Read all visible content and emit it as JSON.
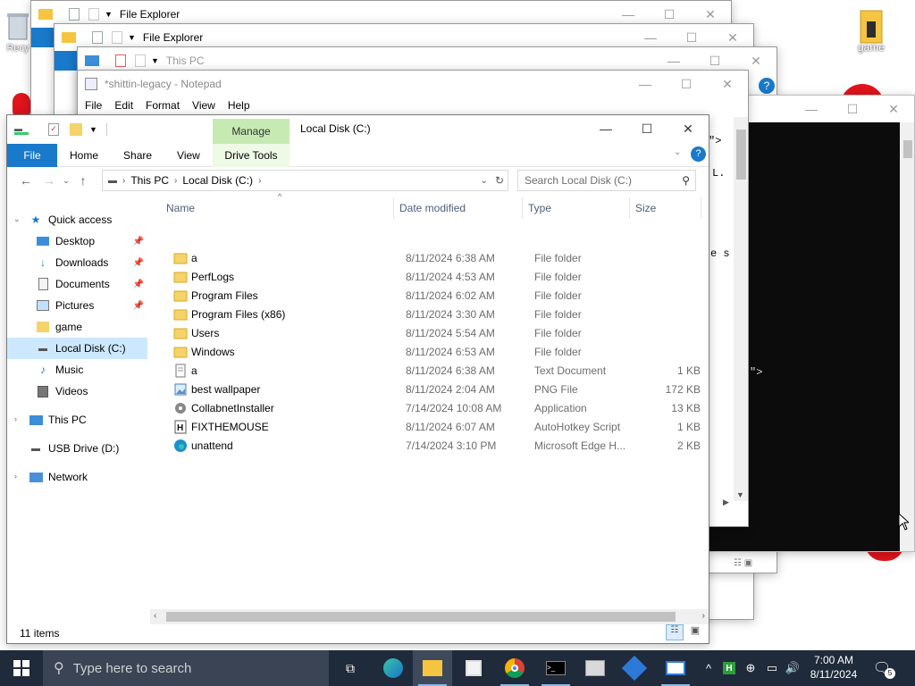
{
  "desktop": {
    "left_icon_label": "Recy",
    "right_icon_label": "game"
  },
  "bg_windows": {
    "explorer1_title": "File Explorer",
    "explorer2_title": "File Explorer",
    "thispc_title": "This PC",
    "notepad_title": "*shittin-legacy - Notepad",
    "notepad_menu": [
      "File",
      "Edit",
      "Format",
      "View",
      "Help"
    ],
    "cmd_fragments": [
      "\">",
      "L.",
      "e s",
      "\">"
    ]
  },
  "main": {
    "title": "Local Disk (C:)",
    "ribbon": {
      "file": "File",
      "home": "Home",
      "share": "Share",
      "view": "View",
      "manage": "Manage",
      "drive_tools": "Drive Tools"
    },
    "address": [
      "This PC",
      "Local Disk (C:)"
    ],
    "search_placeholder": "Search Local Disk (C:)",
    "columns": {
      "name": "Name",
      "date": "Date modified",
      "type": "Type",
      "size": "Size"
    },
    "nav": [
      {
        "label": "Quick access"
      },
      {
        "label": "Desktop"
      },
      {
        "label": "Downloads"
      },
      {
        "label": "Documents"
      },
      {
        "label": "Pictures"
      },
      {
        "label": "game"
      },
      {
        "label": "Local Disk (C:)"
      },
      {
        "label": "Music"
      },
      {
        "label": "Videos"
      },
      {
        "label": "This PC"
      },
      {
        "label": "USB Drive (D:)"
      },
      {
        "label": "Network"
      }
    ],
    "files": [
      {
        "name": "a",
        "date": "8/11/2024 6:38 AM",
        "type": "File folder",
        "size": "",
        "icon": "folder-icon"
      },
      {
        "name": "PerfLogs",
        "date": "8/11/2024 4:53 AM",
        "type": "File folder",
        "size": "",
        "icon": "folder-icon"
      },
      {
        "name": "Program Files",
        "date": "8/11/2024 6:02 AM",
        "type": "File folder",
        "size": "",
        "icon": "folder-icon"
      },
      {
        "name": "Program Files (x86)",
        "date": "8/11/2024 3:30 AM",
        "type": "File folder",
        "size": "",
        "icon": "folder-icon"
      },
      {
        "name": "Users",
        "date": "8/11/2024 5:54 AM",
        "type": "File folder",
        "size": "",
        "icon": "folder-icon"
      },
      {
        "name": "Windows",
        "date": "8/11/2024 6:53 AM",
        "type": "File folder",
        "size": "",
        "icon": "folder-icon"
      },
      {
        "name": "a",
        "date": "8/11/2024 6:38 AM",
        "type": "Text Document",
        "size": "1 KB",
        "icon": "text-file-icon"
      },
      {
        "name": "best wallpaper",
        "date": "8/11/2024 2:04 AM",
        "type": "PNG File",
        "size": "172 KB",
        "icon": "image-file-icon"
      },
      {
        "name": "CollabnetInstaller",
        "date": "7/14/2024 10:08 AM",
        "type": "Application",
        "size": "13 KB",
        "icon": "application-icon"
      },
      {
        "name": "FIXTHEMOUSE",
        "date": "8/11/2024 6:07 AM",
        "type": "AutoHotkey Script",
        "size": "1 KB",
        "icon": "autohotkey-script-icon"
      },
      {
        "name": "unattend",
        "date": "7/14/2024 3:10 PM",
        "type": "Microsoft Edge H...",
        "size": "2 KB",
        "icon": "edge-html-icon"
      }
    ],
    "status": "11 items"
  },
  "taskbar": {
    "search_placeholder": "Type here to search",
    "time": "7:00 AM",
    "date": "8/11/2024",
    "notification_count": "5"
  },
  "colors": {
    "accent": "#1979ca",
    "selection": "#cce8ff",
    "manage_tab": "#c7eab2",
    "taskbar": "#1f2a3a"
  }
}
